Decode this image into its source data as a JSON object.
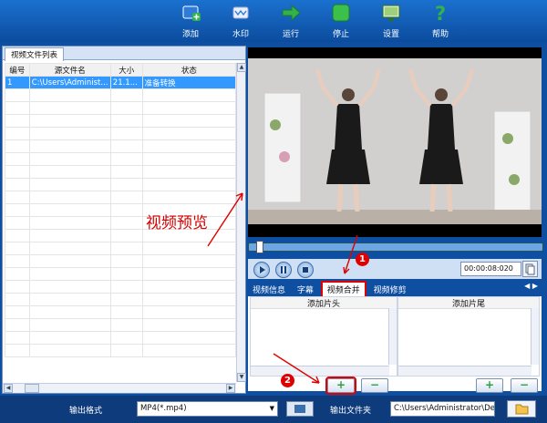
{
  "toolbar": {
    "items": [
      {
        "label": "添加",
        "icon": "add-video-icon"
      },
      {
        "label": "水印",
        "icon": "watermark-icon"
      },
      {
        "label": "运行",
        "icon": "run-arrow-icon"
      },
      {
        "label": "停止",
        "icon": "stop-icon"
      },
      {
        "label": "设置",
        "icon": "settings-monitor-icon"
      },
      {
        "label": "帮助",
        "icon": "help-icon"
      }
    ]
  },
  "file_list": {
    "tab": "视频文件列表",
    "columns": [
      "编号",
      "源文件名",
      "大小",
      "状态"
    ],
    "rows": [
      {
        "id": "1",
        "name": "C:\\Users\\Administ...",
        "size": "21.1...",
        "status": "准备转换"
      }
    ]
  },
  "player": {
    "time": "00:00:08:020",
    "tabs": [
      "视频信息",
      "字幕",
      "视频合并",
      "视频修剪"
    ],
    "active_tab": "视频合并"
  },
  "merge": {
    "head_label": "添加片头",
    "tail_label": "添加片尾"
  },
  "bottom": {
    "format_label": "输出格式",
    "format_value": "MP4(*.mp4)",
    "folder_label": "输出文件夹",
    "folder_value": "C:\\Users\\Administrator\\De"
  },
  "annotations": {
    "preview_text": "视频预览",
    "marker_1": "1",
    "marker_2": "2",
    "color": "#e00000"
  }
}
